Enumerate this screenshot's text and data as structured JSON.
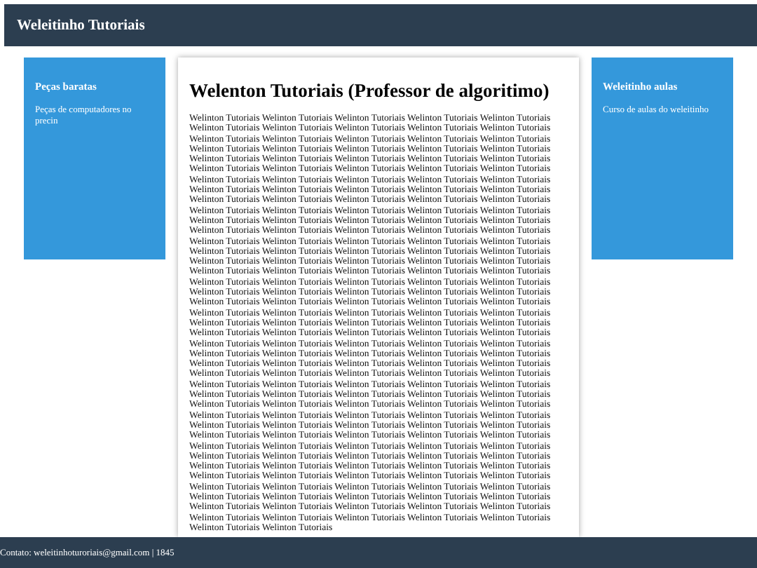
{
  "header": {
    "title": "Weleitinho Tutoriais"
  },
  "left_panel": {
    "title": "Peças baratas",
    "text": "Peças de computadores no precin"
  },
  "main": {
    "title": "Welenton Tutoriais (Professor de algoritimo)",
    "paragraph": "Welinton Tutoriais Welinton Tutoriais Welinton Tutoriais Welinton Tutoriais Welinton Tutoriais Welinton Tutoriais Welinton Tutoriais Welinton Tutoriais Welinton Tutoriais Welinton Tutoriais Welinton Tutoriais Welinton Tutoriais Welinton Tutoriais Welinton Tutoriais Welinton Tutoriais Welinton Tutoriais Welinton Tutoriais Welinton Tutoriais Welinton Tutoriais Welinton Tutoriais Welinton Tutoriais Welinton Tutoriais Welinton Tutoriais Welinton Tutoriais Welinton Tutoriais Welinton Tutoriais Welinton Tutoriais Welinton Tutoriais Welinton Tutoriais Welinton Tutoriais Welinton Tutoriais Welinton Tutoriais Welinton Tutoriais Welinton Tutoriais Welinton Tutoriais Welinton Tutoriais Welinton Tutoriais Welinton Tutoriais Welinton Tutoriais Welinton Tutoriais Welinton Tutoriais Welinton Tutoriais Welinton Tutoriais Welinton Tutoriais Welinton Tutoriais Welinton Tutoriais Welinton Tutoriais Welinton Tutoriais Welinton Tutoriais Welinton Tutoriais Welinton Tutoriais Welinton Tutoriais Welinton Tutoriais Welinton Tutoriais Welinton Tutoriais Welinton Tutoriais Welinton Tutoriais Welinton Tutoriais Welinton Tutoriais Welinton Tutoriais Welinton Tutoriais Welinton Tutoriais Welinton Tutoriais Welinton Tutoriais Welinton Tutoriais Welinton Tutoriais Welinton Tutoriais Welinton Tutoriais Welinton Tutoriais Welinton Tutoriais Welinton Tutoriais Welinton Tutoriais Welinton Tutoriais Welinton Tutoriais Welinton Tutoriais Welinton Tutoriais Welinton Tutoriais Welinton Tutoriais Welinton Tutoriais Welinton Tutoriais Welinton Tutoriais Welinton Tutoriais Welinton Tutoriais Welinton Tutoriais Welinton Tutoriais Welinton Tutoriais Welinton Tutoriais Welinton Tutoriais Welinton Tutoriais Welinton Tutoriais Welinton Tutoriais Welinton Tutoriais Welinton Tutoriais Welinton Tutoriais Welinton Tutoriais Welinton Tutoriais Welinton Tutoriais Welinton Tutoriais Welinton Tutoriais Welinton Tutoriais Welinton Tutoriais Welinton Tutoriais Welinton Tutoriais Welinton Tutoriais Welinton Tutoriais Welinton Tutoriais Welinton Tutoriais Welinton Tutoriais Welinton Tutoriais Welinton Tutoriais Welinton Tutoriais Welinton Tutoriais Welinton Tutoriais Welinton Tutoriais Welinton Tutoriais Welinton Tutoriais Welinton Tutoriais Welinton Tutoriais Welinton Tutoriais Welinton Tutoriais Welinton Tutoriais Welinton Tutoriais Welinton Tutoriais Welinton Tutoriais Welinton Tutoriais Welinton Tutoriais Welinton Tutoriais Welinton Tutoriais Welinton Tutoriais Welinton Tutoriais Welinton Tutoriais Welinton Tutoriais Welinton Tutoriais Welinton Tutoriais Welinton Tutoriais Welinton Tutoriais Welinton Tutoriais Welinton Tutoriais Welinton Tutoriais Welinton Tutoriais Welinton Tutoriais Welinton Tutoriais Welinton Tutoriais Welinton Tutoriais Welinton Tutoriais Welinton Tutoriais Welinton Tutoriais Welinton Tutoriais Welinton Tutoriais Welinton Tutoriais Welinton Tutoriais Welinton Tutoriais Welinton Tutoriais Welinton Tutoriais Welinton Tutoriais Welinton Tutoriais Welinton Tutoriais Welinton Tutoriais Welinton Tutoriais Welinton Tutoriais Welinton Tutoriais Welinton Tutoriais Welinton Tutoriais Welinton Tutoriais Welinton Tutoriais Welinton Tutoriais Welinton Tutoriais Welinton Tutoriais Welinton Tutoriais Welinton Tutoriais Welinton Tutoriais Welinton Tutoriais Welinton Tutoriais Welinton Tutoriais Welinton Tutoriais Welinton Tutoriais Welinton Tutoriais Welinton Tutoriais Welinton Tutoriais Welinton Tutoriais Welinton Tutoriais Welinton Tutoriais Welinton Tutoriais Welinton Tutoriais Welinton Tutoriais Welinton Tutoriais Welinton Tutoriais Welinton Tutoriais Welinton Tutoriais Welinton Tutoriais Welinton Tutoriais Welinton Tutoriais Welinton Tutoriais Welinton Tutoriais Welinton Tutoriais Welinton Tutoriais Welinton Tutoriais Welinton Tutoriais Welinton Tutoriais Welinton Tutoriais Welinton Tutoriais Welinton Tutoriais"
  },
  "right_panel": {
    "title": "Weleitinho aulas",
    "text": "Curso de aulas do weleitinho"
  },
  "footer": {
    "text": "Contato: weleitinhoturoriais@gmail.com | 1845"
  }
}
